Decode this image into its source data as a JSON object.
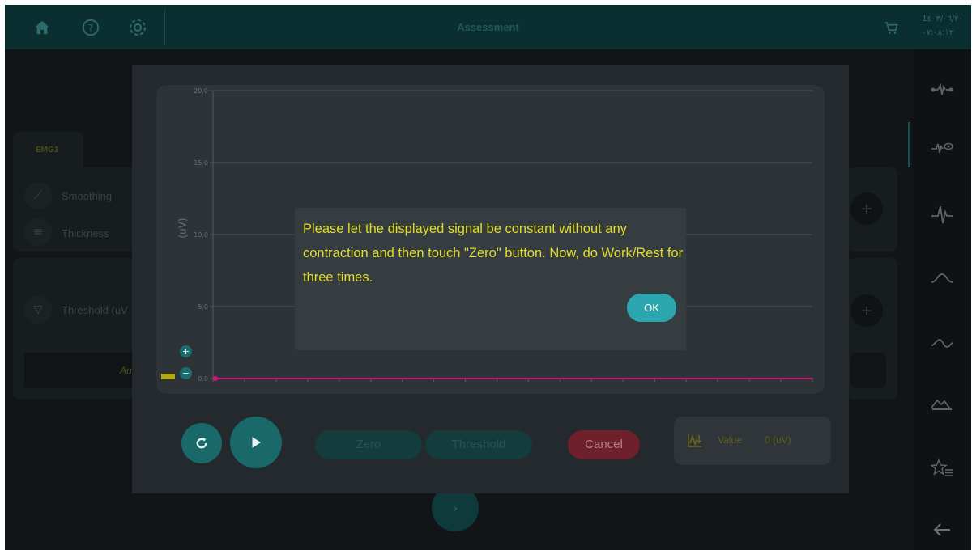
{
  "topbar": {
    "title": "Assessment",
    "version_line1": "1٤٠٣/٠٦/٢٠",
    "version_line2": "٠٧:٠٨:١٢",
    "icons": [
      "home-icon",
      "help-icon",
      "settings-icon",
      "cart-icon"
    ]
  },
  "sidebar": {
    "icons": [
      "electrode-icon",
      "emg-eye-icon",
      "emg-signal-icon",
      "wave-low-icon",
      "wave-sine-icon",
      "workout-icon",
      "star-list-icon",
      "back-arrow-icon"
    ]
  },
  "background": {
    "tab_label": "EMG1",
    "smoothing_label": "Smoothing",
    "thickness_label": "Thickness",
    "threshold_label": "Threshold (uV",
    "auto_label": "Au",
    "plus": "+",
    "next": "›"
  },
  "plot": {
    "ylabel": "(uV)",
    "zoom_in": "+",
    "zoom_out": "−"
  },
  "chart_data": {
    "type": "line",
    "ylabel": "(uV)",
    "ylim": [
      0,
      20
    ],
    "yticks": [
      "0.0",
      "5.0",
      "10.0",
      "15.0",
      "20.0"
    ],
    "grid": true,
    "series": [
      {
        "values": [
          0,
          0
        ]
      }
    ]
  },
  "controls": {
    "zero_label": "Zero",
    "threshold_label": "Threshold",
    "cancel_label": "Cancel",
    "value_label": "Value",
    "value": "0 (uV)"
  },
  "dialog": {
    "message": "Please let the displayed signal be constant without any contraction and then touch \"Zero\" button. Now, do Work/Rest for three times.",
    "ok_label": "OK"
  },
  "colors": {
    "accent": "#2ba5ae",
    "dialog_text": "#e1dd28",
    "signal": "#d01477",
    "cancel": "#6e202b"
  }
}
